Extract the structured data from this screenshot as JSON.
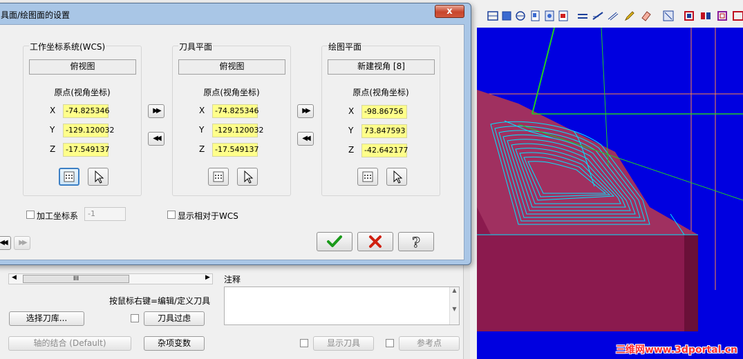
{
  "dialog": {
    "title": "具面/绘图面的设置",
    "close_glyph": "x",
    "groups": [
      {
        "title": "工作坐标系统(WCS)",
        "view": "俯视图",
        "origin_label": "原点(视角坐标)",
        "x": "-74.825346",
        "y": "-129.120032",
        "z": "-17.549137"
      },
      {
        "title": "刀具平面",
        "view": "俯视图",
        "origin_label": "原点(视角坐标)",
        "x": "-74.825346",
        "y": "-129.120032",
        "z": "-17.549137"
      },
      {
        "title": "绘图平面",
        "view": "新建视角 [8]",
        "origin_label": "原点(视角坐标)",
        "x": "-98.86756",
        "y": "73.847593",
        "z": "-42.642177"
      }
    ],
    "axis_labels": {
      "x": "X",
      "y": "Y",
      "z": "Z"
    },
    "work_offset_label": "加工坐标系",
    "work_offset_value": "-1",
    "relative_wcs_label": "显示相对于WCS",
    "nav": {
      "prev": "◀◀",
      "next": "▶▶"
    }
  },
  "lower_panel": {
    "scroll_thumb": "III",
    "right_click_hint": "按鼠标右键=编辑/定义刀具",
    "select_library_button": "选择刀库...",
    "tool_filter_button": "刀具过虑",
    "axis_combination_button": "轴的结合 (Default)",
    "misc_values_button": "杂项变数",
    "show_tool_button": "显示刀具",
    "reference_point_button": "参考点",
    "notes_label": "注释"
  },
  "viewport": {
    "watermark": "三维网www.3dportal.cn",
    "colors": {
      "background": "#0000e0",
      "part": "#8b1a4e",
      "toolpath": "#00e5ff",
      "wcs": "#22cc22",
      "border": "#ff8844"
    }
  },
  "colors": {
    "coord_field": "#ffff8a",
    "ok": "#1a9a1a",
    "cancel": "#d02010",
    "help": "#555555"
  }
}
